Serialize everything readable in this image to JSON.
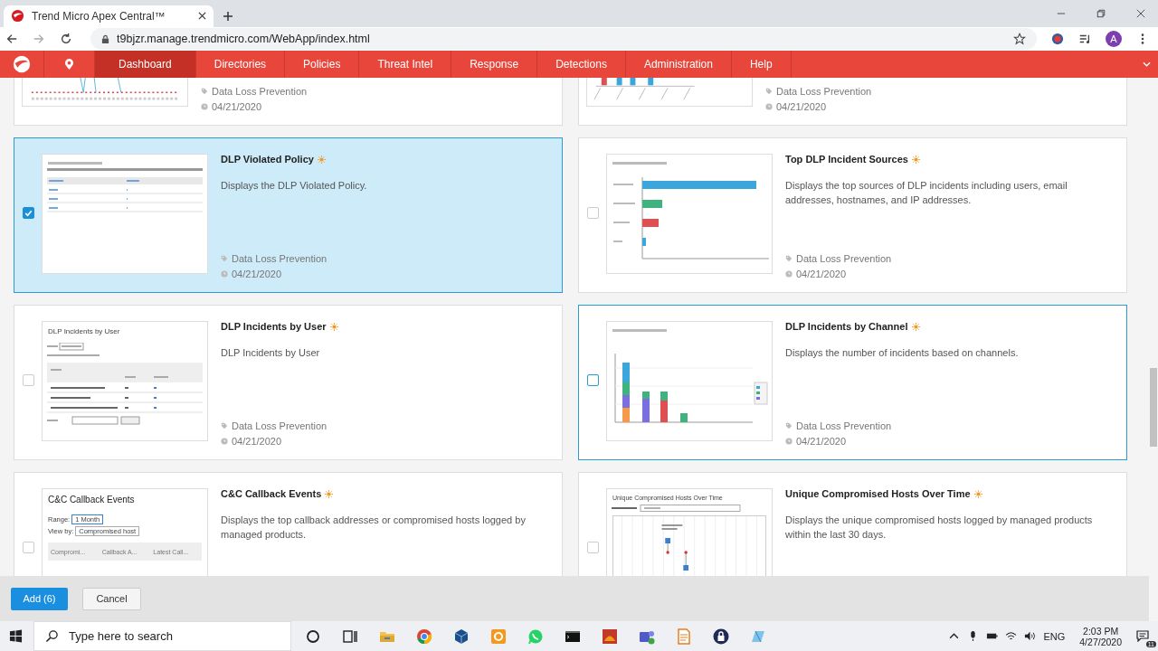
{
  "browser": {
    "tab_title": "Trend Micro Apex Central™",
    "url": "t9bjzr.manage.trendmicro.com/WebApp/index.html",
    "profile": "A"
  },
  "nav": [
    {
      "label": "Dashboard",
      "selected": true
    },
    {
      "label": "Directories",
      "selected": false
    },
    {
      "label": "Policies",
      "selected": false
    },
    {
      "label": "Threat Intel",
      "selected": false
    },
    {
      "label": "Response",
      "selected": false
    },
    {
      "label": "Detections",
      "selected": false
    },
    {
      "label": "Administration",
      "selected": false
    },
    {
      "label": "Help",
      "selected": false
    }
  ],
  "cards": [
    {
      "category": "Data Loss Prevention",
      "date": "04/21/2020",
      "thumb": {
        "kind": "line-partial"
      }
    },
    {
      "category": "Data Loss Prevention",
      "date": "04/21/2020",
      "thumb": {
        "kind": "bars-partial"
      }
    },
    {
      "title": "DLP Violated Policy",
      "description": "Displays the DLP Violated Policy.",
      "category": "Data Loss Prevention",
      "date": "04/21/2020",
      "checked": true,
      "hovered": false,
      "thumb": {
        "kind": "policy-table"
      }
    },
    {
      "title": "Top DLP Incident Sources",
      "description": "Displays the top sources of DLP incidents including users, email addresses, hostnames, and IP addresses.",
      "category": "Data Loss Prevention",
      "date": "04/21/2020",
      "checked": false,
      "hovered": false,
      "thumb": {
        "kind": "hbar"
      }
    },
    {
      "title": "DLP Incidents by User",
      "description": "DLP Incidents by User",
      "category": "Data Loss Prevention",
      "date": "04/21/2020",
      "checked": false,
      "hovered": false,
      "thumb": {
        "kind": "user-table",
        "title": "DLP Incidents by User"
      }
    },
    {
      "title": "DLP Incidents by Channel",
      "description": "Displays the number of incidents based on channels.",
      "category": "Data Loss Prevention",
      "date": "04/21/2020",
      "checked": false,
      "hovered": true,
      "thumb": {
        "kind": "stacked"
      }
    },
    {
      "title": "C&C Callback Events",
      "description": "Displays the top callback addresses or compromised hosts logged by managed products.",
      "checked": false,
      "hovered": false,
      "thumb": {
        "kind": "callback",
        "title": "C&C Callback Events",
        "range_label": "Range:",
        "range": "1 Month",
        "view_label": "View by:",
        "view": "Compromised host",
        "columns": [
          "Compromi...",
          "Callback A...",
          "Latest Call..."
        ]
      }
    },
    {
      "title": "Unique Compromised Hosts Over Time",
      "description": "Displays the unique compromised hosts logged by managed products within the last 30 days.",
      "checked": false,
      "hovered": false,
      "thumb": {
        "kind": "timeline",
        "title": "Unique Compromised Hosts Over Time"
      }
    }
  ],
  "footer": {
    "add": "Add (6)",
    "cancel": "Cancel"
  },
  "taskbar": {
    "search_placeholder": "Type here to search",
    "language": "ENG",
    "time": "2:03 PM",
    "date": "4/27/2020",
    "notifications": "11"
  }
}
